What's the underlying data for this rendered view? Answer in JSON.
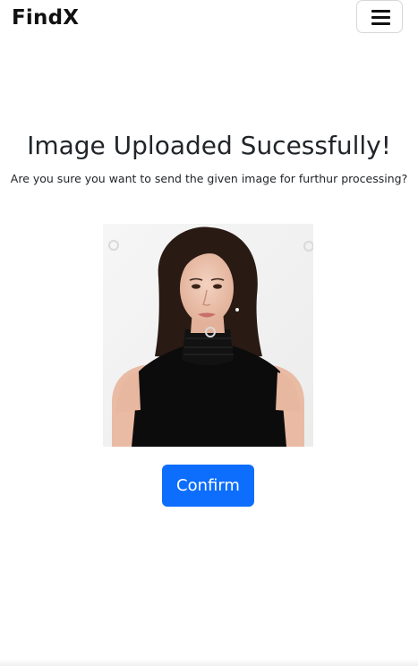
{
  "navbar": {
    "brand": "FindX",
    "menu_icon": "hamburger-menu-icon"
  },
  "main": {
    "title": "Image Uploaded Sucessfully!",
    "subtitle": "Are you sure you want to send the given image for furthur processing?",
    "confirm_label": "Confirm"
  },
  "colors": {
    "accent": "#0d6efd",
    "text": "#212529",
    "background": "#ffffff"
  }
}
